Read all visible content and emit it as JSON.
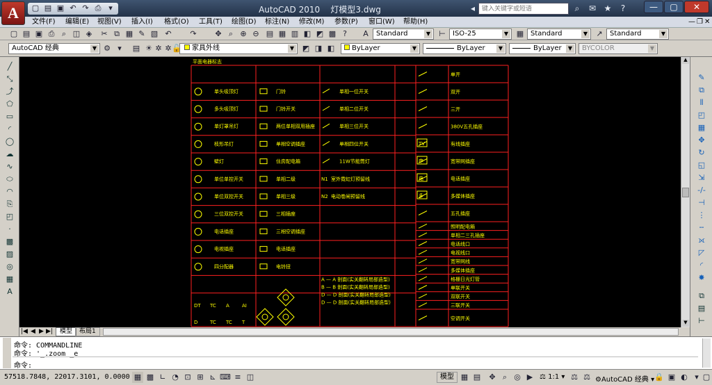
{
  "app": {
    "logo": "A",
    "title": "AutoCAD 2010",
    "file": "灯模型3.dwg"
  },
  "search": {
    "placeholder": "键入关键字或短语"
  },
  "menus": [
    "文件(F)",
    "编辑(E)",
    "视图(V)",
    "插入(I)",
    "格式(O)",
    "工具(T)",
    "绘图(D)",
    "标注(N)",
    "修改(M)",
    "参数(P)",
    "窗口(W)",
    "帮助(H)"
  ],
  "styles": {
    "text_style": "Standard",
    "dim_style": "ISO-25",
    "table_style": "Standard",
    "multileader_style": "Standard"
  },
  "layers": {
    "workspace": "AutoCAD 经典",
    "current_layer": "家具外线",
    "color": "ByLayer",
    "linetype": "ByLayer",
    "lineweight": "ByLayer",
    "plotstyle": "BYCOLOR"
  },
  "drawing": {
    "title": "平面电器标志",
    "col1": [
      "单头吸顶灯",
      "多头吸顶灯",
      "单灯罩吊灯",
      "枝形吊灯",
      "壁灯",
      "单位单控开关",
      "单位双控开关",
      "三位双控开关",
      "电话插座",
      "电视插座",
      "四分配器"
    ],
    "col2": [
      "门铃",
      "门铃开关",
      "两位单相双用插座",
      "单相空调插座",
      "住房配电箱",
      "单相二级",
      "单相三级",
      "三相插座",
      "三相空调插座",
      "电话插座",
      "电铃扭"
    ],
    "col3": [
      "单相一位开关",
      "单相二位开关",
      "单相三位开关",
      "单相四位开关",
      "11W节能筒灯"
    ],
    "col3_lines": [
      {
        "code": "N1",
        "label": "室外霓虹灯预留线"
      },
      {
        "code": "N2",
        "label": "电动卷闸预留线"
      }
    ],
    "col4": [
      "单开",
      "双开",
      "三开",
      "380V五孔插座",
      "有线插座",
      "宽带网插座",
      "电话插座",
      "多媒体插座",
      "五孔插座",
      "照明配电箱",
      "单相二三孔插座",
      "电话线口",
      "电视线口",
      "宽带网线",
      "多媒体插座",
      "格栅日光灯管",
      "单联开关",
      "双联开关",
      "三联开关",
      "空调开关"
    ],
    "section_rows": [
      "A — A 剖面(实关翻转局部造型)",
      "B — B 剖面(实关翻转局部造型)",
      "D — D 剖面(实关翻转局部造型)",
      "D — D 剖面(实关翻转局部造型)"
    ],
    "symbol_letters_top": [
      "DT",
      "TC",
      "A",
      "AI"
    ],
    "symbol_letters_bottom": [
      "D",
      "TC",
      "TC",
      "T"
    ],
    "col4_box_labels": [
      "TV",
      "申",
      "电",
      "多"
    ]
  },
  "tabs": {
    "model": "模型",
    "layout1": "布局1"
  },
  "command_history": [
    "命令: COMMANDLINE",
    "命令: '_.zoom _e"
  ],
  "command_prompt": "命令:",
  "status": {
    "coords": "57518.7848, 22017.3101, 0.0000",
    "model_label": "模型",
    "scale": "1:1",
    "workspace": "AutoCAD 经典"
  },
  "colors": {
    "canvas": "#000000",
    "grid_lines": "#ff2020",
    "cad_text": "#ffff00",
    "ribbon_title": "#233248"
  }
}
